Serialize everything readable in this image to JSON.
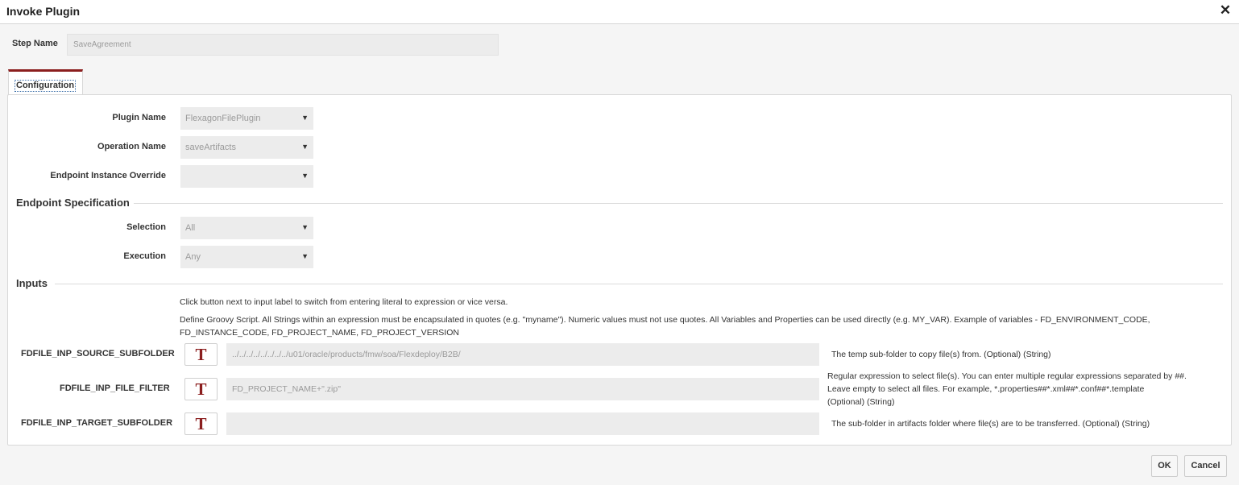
{
  "dialog": {
    "title": "Invoke Plugin",
    "close_icon": "✕"
  },
  "step": {
    "label": "Step Name",
    "value": "SaveAgreement"
  },
  "tabs": [
    {
      "label": "Configuration"
    }
  ],
  "config": {
    "plugin_name": {
      "label": "Plugin Name",
      "value": "FlexagonFilePlugin"
    },
    "operation_name": {
      "label": "Operation Name",
      "value": "saveArtifacts"
    },
    "endpoint_instance_override": {
      "label": "Endpoint Instance Override",
      "value": ""
    }
  },
  "endpoint_spec": {
    "title": "Endpoint Specification",
    "selection": {
      "label": "Selection",
      "value": "All"
    },
    "execution": {
      "label": "Execution",
      "value": "Any"
    }
  },
  "inputs": {
    "title": "Inputs",
    "help1": "Click button next to input label to switch from entering literal to expression or vice versa.",
    "help2_line1": "Define Groovy Script. All Strings within an expression must be encapsulated in quotes (e.g. \"myname\"). Numeric values must not use quotes. All Variables and Properties can be used directly (e.g. MY_VAR). Example of variables - FD_ENVIRONMENT_CODE,",
    "help2_line2": "FD_INSTANCE_CODE, FD_PROJECT_NAME, FD_PROJECT_VERSION",
    "toggle_glyph": "T",
    "items": [
      {
        "label": "FDFILE_INP_SOURCE_SUBFOLDER",
        "value": "../../../../../../../../u01/oracle/products/fmw/soa/Flexdeploy/B2B/",
        "desc_lines": [
          "The temp sub-folder to copy file(s) from. (Optional) (String)"
        ]
      },
      {
        "label": "FDFILE_INP_FILE_FILTER",
        "value": "FD_PROJECT_NAME+\".zip\"",
        "desc_lines": [
          "Regular expression to select file(s). You can enter multiple regular expressions separated by ##.",
          "Leave empty to select all files. For example, *.properties##*.xml##*.conf##*.template",
          "(Optional) (String)"
        ]
      },
      {
        "label": "FDFILE_INP_TARGET_SUBFOLDER",
        "value": "",
        "desc_lines": [
          "The sub-folder in artifacts folder where file(s) are to be transferred. (Optional) (String)"
        ]
      }
    ]
  },
  "footer": {
    "ok_label": "OK",
    "cancel_label": "Cancel"
  },
  "colors": {
    "accent": "#8b1e1e",
    "field_bg": "#ececec",
    "panel_border": "#d8d8d8"
  }
}
